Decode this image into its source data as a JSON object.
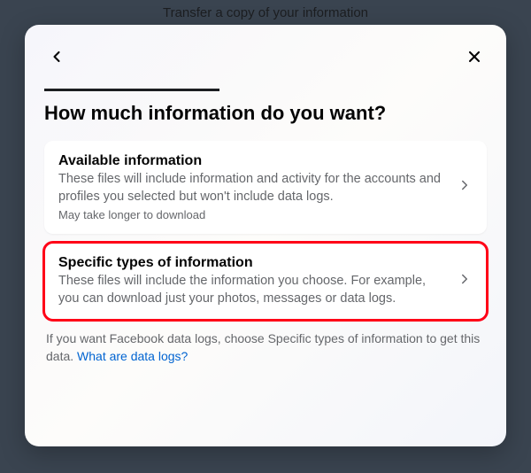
{
  "background": {
    "page_title": "Transfer a copy of your information"
  },
  "modal": {
    "title": "How much information do you want?",
    "options": [
      {
        "title": "Available information",
        "description": "These files will include information and activity for the accounts and profiles you selected but won't include data logs.",
        "note": "May take longer to download"
      },
      {
        "title": "Specific types of information",
        "description": "These files will include the information you choose. For example, you can download just your photos, messages or data logs."
      }
    ],
    "hint": {
      "text_before": "If you want Facebook data logs, choose Specific types of information to get this data. ",
      "link_text": "What are data logs?"
    }
  }
}
